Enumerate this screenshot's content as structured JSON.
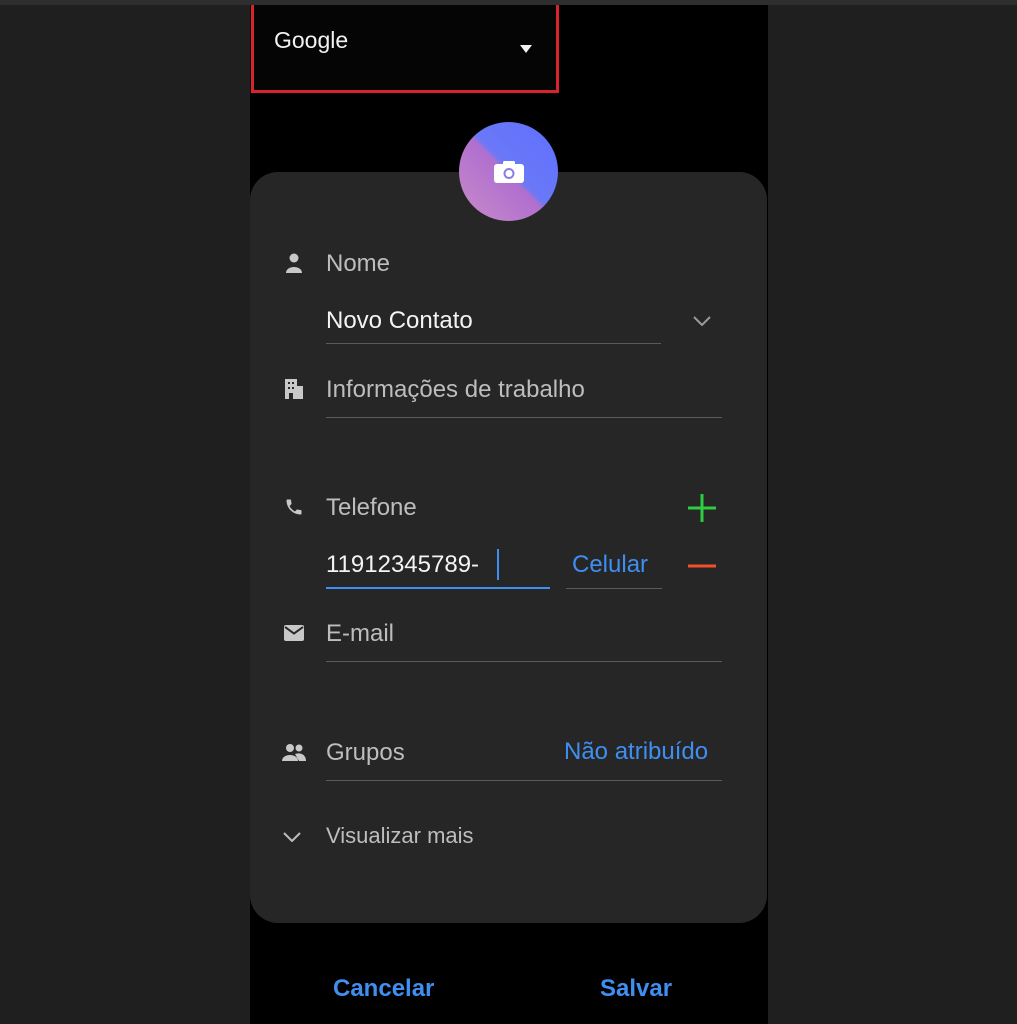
{
  "account": {
    "label": "Google"
  },
  "form": {
    "name_label": "Nome",
    "name_value": "Novo Contato",
    "work_label": "Informações de trabalho",
    "phone_label": "Telefone",
    "phone_value": "11912345789-",
    "phone_type": "Celular",
    "email_placeholder": "E-mail",
    "groups_label": "Grupos",
    "groups_value": "Não atribuído",
    "view_more": "Visualizar mais"
  },
  "footer": {
    "cancel": "Cancelar",
    "save": "Salvar"
  },
  "icons": [
    "caret-down-icon",
    "camera-icon",
    "person-icon",
    "chevron-down-icon",
    "building-icon",
    "phone-icon",
    "plus-icon",
    "minus-icon",
    "mail-icon",
    "groups-icon"
  ],
  "colors": {
    "accent": "#3f8ff0",
    "add": "#2ecc40",
    "remove": "#f0502a",
    "highlight_border": "#d8222c"
  }
}
